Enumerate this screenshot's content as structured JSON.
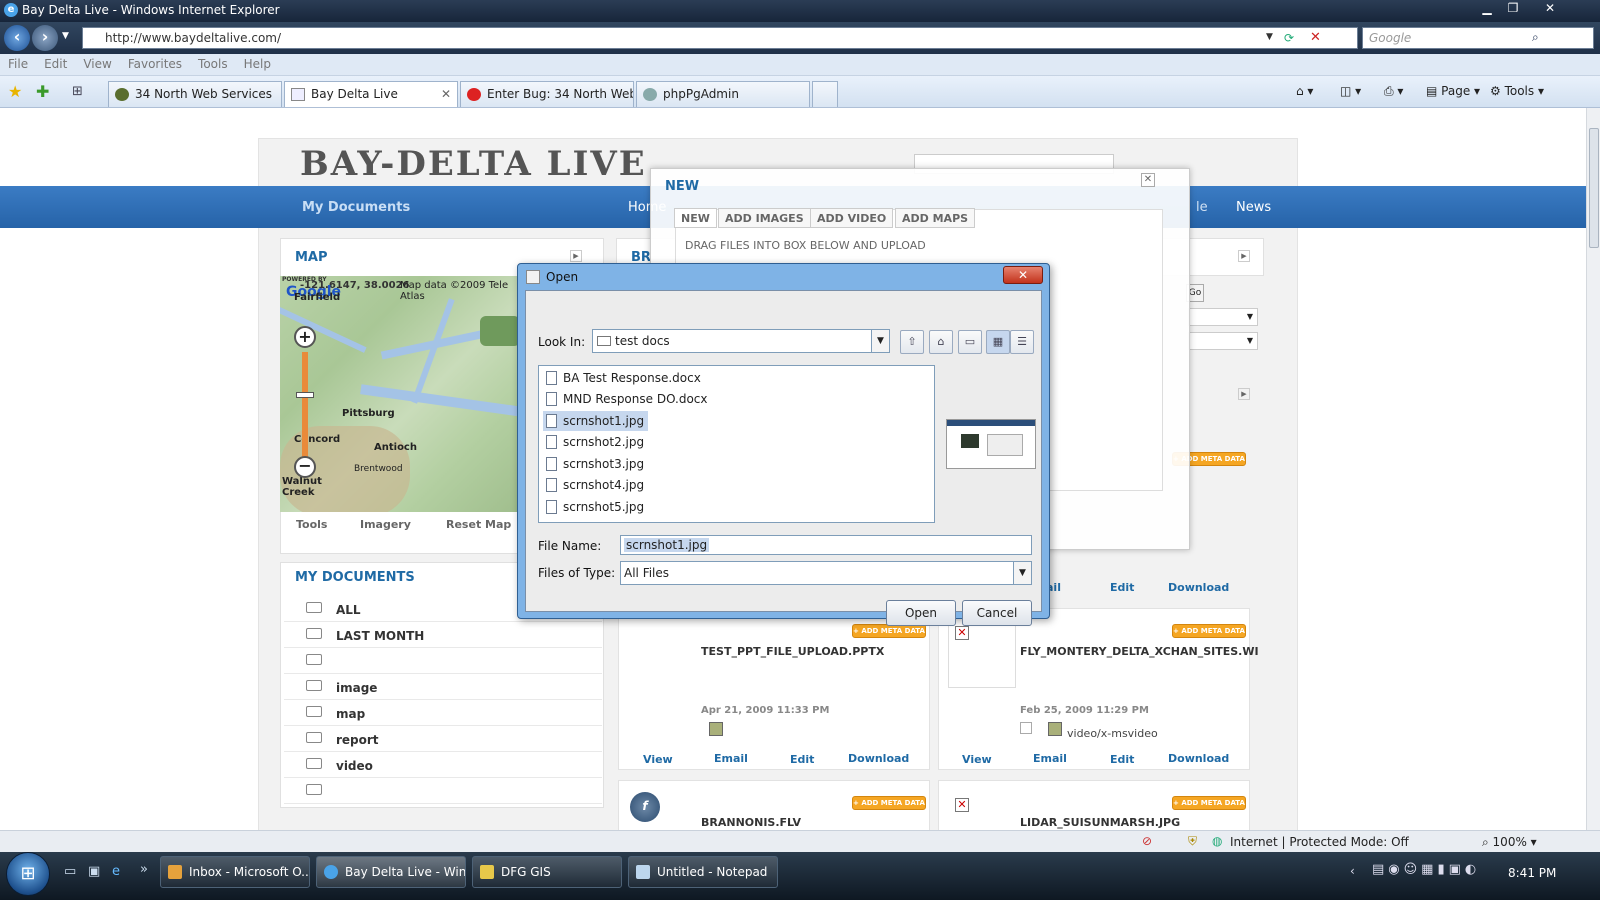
{
  "window": {
    "title": "Bay Delta Live - Windows Internet Explorer"
  },
  "address": {
    "url": "http://www.baydeltalive.com/",
    "search_placeholder": "Google"
  },
  "menu": [
    "File",
    "Edit",
    "View",
    "Favorites",
    "Tools",
    "Help"
  ],
  "browser_tabs": [
    {
      "label": "34 North Web Services"
    },
    {
      "label": "Bay Delta Live"
    },
    {
      "label": "Enter Bug: 34 North Websi..."
    },
    {
      "label": "phpPgAdmin"
    }
  ],
  "commands": {
    "page": "Page",
    "tools": "Tools"
  },
  "site": {
    "logo": "BAY-DELTA LIVE",
    "nav": {
      "my_documents": "My Documents",
      "home": "Home",
      "le": "le",
      "news": "News"
    },
    "map_panel": {
      "title": "MAP",
      "coords": "-121.6147, 38.0026",
      "attribution": "Map data ©2009 Tele Atlas",
      "powered": "POWERED BY",
      "google": "Google",
      "places": [
        "Fairfield",
        "Pittsburg",
        "Concord",
        "Antioch",
        "Brentwood",
        "Walnut Creek"
      ],
      "tabs": [
        "Tools",
        "Imagery",
        "Reset Map"
      ]
    },
    "browse_panel": {
      "title": "BR"
    },
    "go_label": "Go",
    "my_docs": {
      "title": "MY DOCUMENTS",
      "items": [
        "ALL",
        "LAST MONTH",
        "",
        "image",
        "map",
        "report",
        "video",
        ""
      ]
    },
    "add_meta": "+ ADD META DATA",
    "cards": [
      {
        "name": "TEST_PPT_FILE_UPLOAD.PPTX",
        "date": "Apr 21, 2009 11:33 PM",
        "mime": "",
        "links": [
          "View",
          "Email",
          "Edit",
          "Download"
        ]
      },
      {
        "name": "FLY_MONTERY_DELTA_XCHAN_SITES.WI",
        "date": "Feb 25, 2009 11:29 PM",
        "mime": "video/x-msvideo",
        "links": [
          "View",
          "Email",
          "Edit",
          "Download"
        ]
      },
      {
        "name": "BRANNONIS.FLV"
      },
      {
        "name": "LIDAR_SUISUNMARSH.JPG"
      }
    ],
    "top_card_links": [
      "ail",
      "Edit",
      "Download"
    ]
  },
  "new_modal": {
    "title": "NEW",
    "tabs": [
      "NEW",
      "ADD IMAGES",
      "ADD VIDEO",
      "ADD MAPS"
    ],
    "instruction": "DRAG FILES INTO BOX BELOW AND UPLOAD"
  },
  "open_dialog": {
    "title": "Open",
    "look_in_label": "Look In:",
    "look_in_value": "test docs",
    "files": [
      "BA Test Response.docx",
      "MND Response DO.docx",
      "scrnshot1.jpg",
      "scrnshot2.jpg",
      "scrnshot3.jpg",
      "scrnshot4.jpg",
      "scrnshot5.jpg"
    ],
    "selected_index": 2,
    "file_name_label": "File Name:",
    "file_name_value": "scrnshot1.jpg",
    "file_type_label": "Files of Type:",
    "file_type_value": "All Files",
    "open_button": "Open",
    "cancel_button": "Cancel"
  },
  "status": {
    "zone": "Internet | Protected Mode: Off",
    "zoom": "100%"
  },
  "taskbar": {
    "tasks": [
      "Inbox - Microsoft O...",
      "Bay Delta Live - Win...",
      "DFG GIS",
      "Untitled - Notepad"
    ],
    "clock": "8:41 PM"
  },
  "colors": {
    "site_blue": "#2663a8",
    "accent_orange": "#f5a623",
    "link_blue": "#1f6aa5"
  }
}
